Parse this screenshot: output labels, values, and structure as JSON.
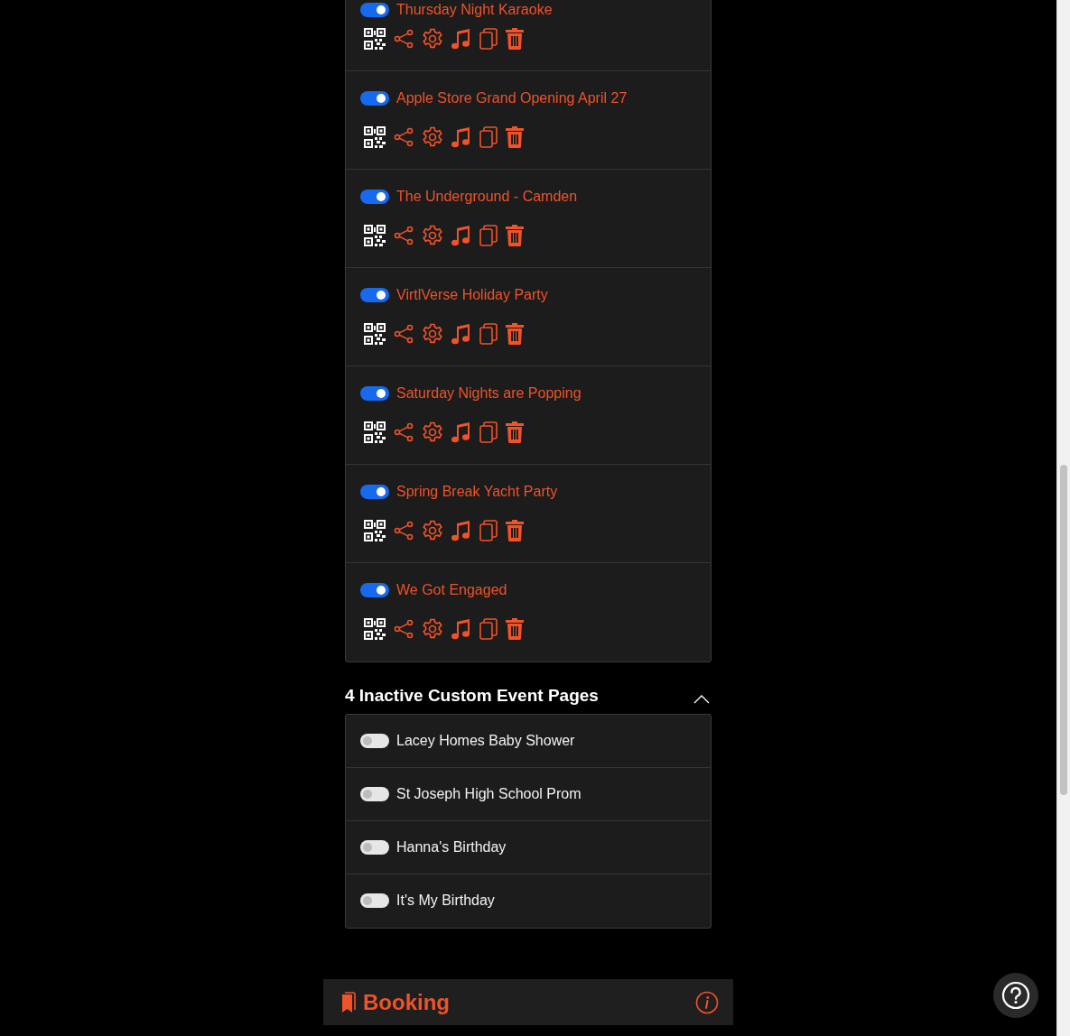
{
  "active_events": [
    {
      "title": "Thursday Night Karaoke",
      "on": true
    },
    {
      "title": "Apple Store Grand Opening April 27",
      "on": true
    },
    {
      "title": "The Underground - Camden",
      "on": true
    },
    {
      "title": "VirtlVerse Holiday Party",
      "on": true
    },
    {
      "title": "Saturday Nights are Popping",
      "on": true
    },
    {
      "title": "Spring Break Yacht Party",
      "on": true
    },
    {
      "title": "We Got Engaged",
      "on": true
    }
  ],
  "inactive_section": {
    "title": "4 Inactive Custom Event Pages",
    "expanded": true,
    "events": [
      {
        "title": "Lacey Homes Baby Shower",
        "on": false
      },
      {
        "title": "St Joseph High School Prom",
        "on": false
      },
      {
        "title": "Hanna's Birthday",
        "on": false
      },
      {
        "title": "It's My Birthday",
        "on": false
      }
    ]
  },
  "booking": {
    "title": "Booking"
  }
}
